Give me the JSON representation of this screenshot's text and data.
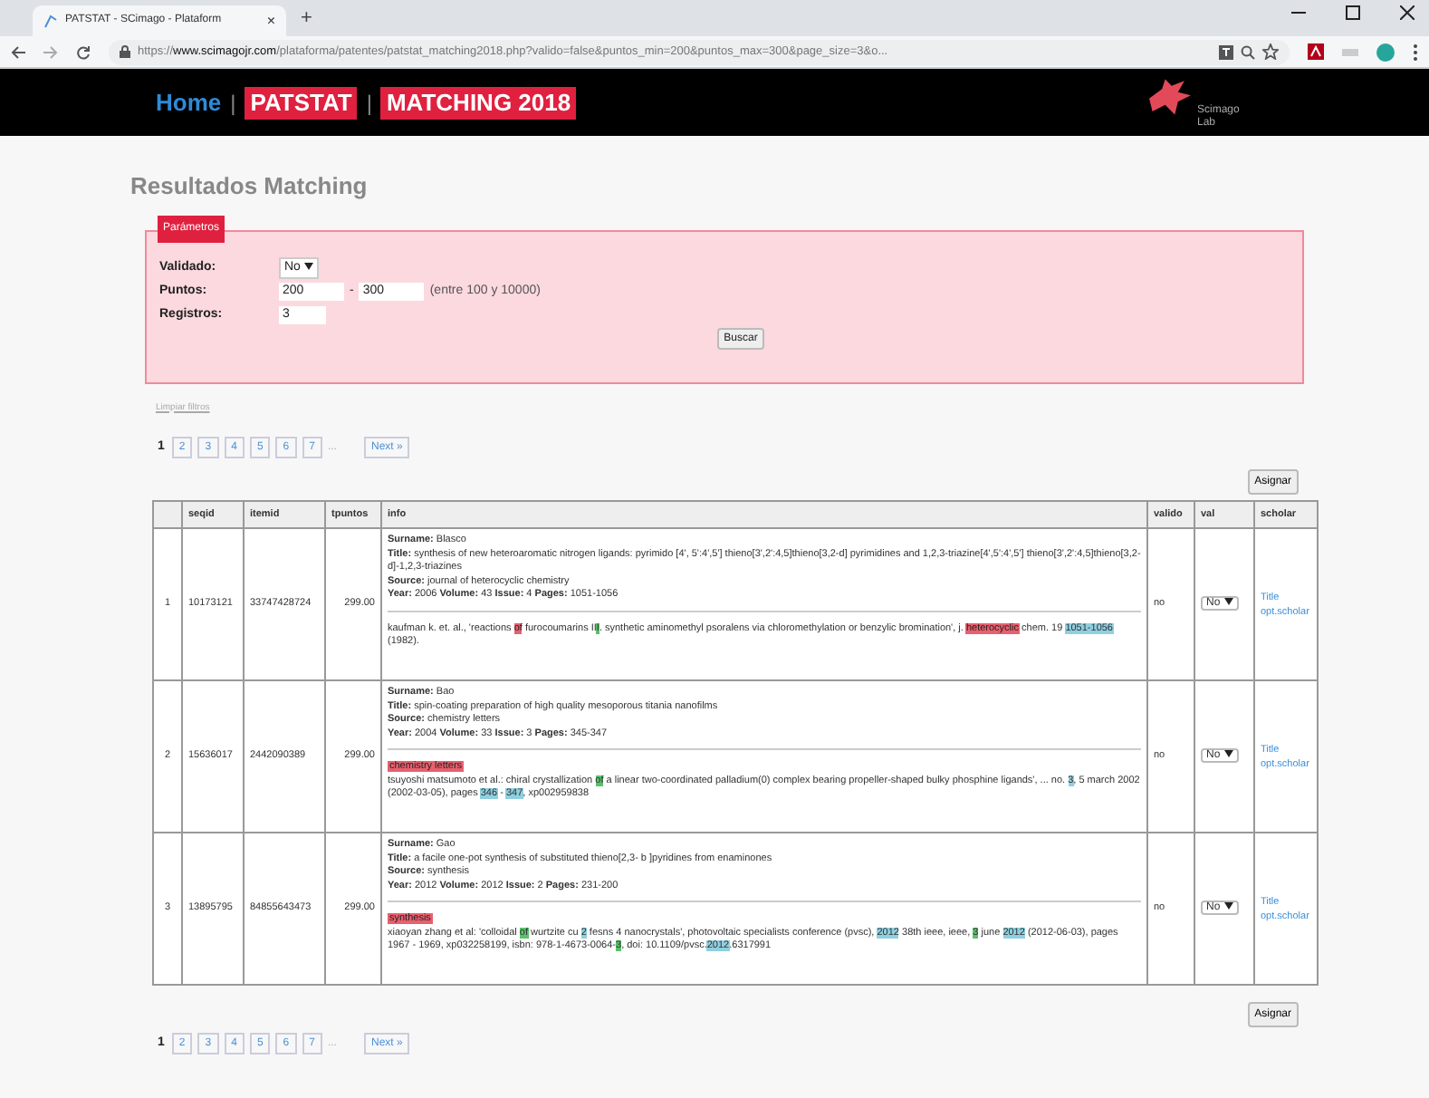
{
  "browser": {
    "tab_title": "PATSTAT - SCimago - Plataform",
    "tab_close": "×",
    "new_tab": "+",
    "url_scheme": "https://",
    "url_host": "www.scimagojr.com",
    "url_path": "/plataforma/patentes/patstat_matching2018.php?valido=false&puntos_min=200&puntos_max=300&page_size=3&o..."
  },
  "header": {
    "nav": [
      {
        "label": "Home",
        "kind": "link"
      },
      {
        "label": "|",
        "kind": "separator"
      },
      {
        "label": "PATSTAT",
        "kind": "badge"
      },
      {
        "label": "|",
        "kind": "separator"
      },
      {
        "label": "MATCHING 2018",
        "kind": "badge"
      }
    ],
    "logo_text": "Scimago Lab"
  },
  "page_title": "Resultados Matching",
  "params": {
    "legend": "Parámetros",
    "validado_label": "Validado:",
    "validado_value": "No",
    "puntos_label": "Puntos:",
    "puntos_min": "200",
    "dash": "-",
    "puntos_max": "300",
    "puntos_hint": "(entre 100 y 10000)",
    "registros_label": "Registros:",
    "registros_value": "3",
    "button": "Buscar"
  },
  "clear_link": "Limpiar filtros",
  "pagination_top": {
    "pages": [
      {
        "label": "1",
        "selected": true
      },
      {
        "label": "2",
        "selected": false
      },
      {
        "label": "3",
        "selected": false
      },
      {
        "label": "4",
        "selected": false
      },
      {
        "label": "5",
        "selected": false
      },
      {
        "label": "6",
        "selected": false
      },
      {
        "label": "7",
        "selected": false
      }
    ],
    "ellipsis": "...",
    "next": "Next »"
  },
  "assign_top": "Asignar",
  "table": {
    "columns": [
      "seqid",
      "itemid",
      "tpuntos",
      "info",
      "valido",
      "val",
      "scholar"
    ],
    "rows": [
      {
        "index": "1",
        "seqid": "10173121",
        "itemid": "33747428724",
        "tpuntos": "299.00",
        "info_lines": [
          [
            {
              "label": "Surname:",
              "value": "Blasco"
            }
          ],
          [
            {
              "label": "Title:",
              "value": "synthesis of new heteroaromatic nitrogen ligands: pyrimido [4', 5':4',5'] thieno[3',2':4,5]thieno[3,2-d] pyrimidines and 1,2,3-triazine[4',5':4',5'] thieno[3',2':4,5]thieno[3,2-d]-1,2,3-triazines"
            }
          ],
          [
            {
              "label": "Source:",
              "value": "journal of heterocyclic chemistry"
            }
          ],
          [
            {
              "label": "Year:",
              "value": "2006"
            },
            {
              "label": "Volume:",
              "value": "43"
            },
            {
              "label": "Issue:",
              "value": "4"
            },
            {
              "label": "Pages:",
              "value": "1051-1056"
            }
          ]
        ],
        "citation": [
          {
            "text": "kaufman k. et. al., 'reactions ",
            "kind": "plain"
          },
          {
            "text": "of",
            "kind": "red"
          },
          {
            "text": " furocoumarins II",
            "kind": "plain"
          },
          {
            "text": "I",
            "kind": "green"
          },
          {
            "text": ". synthetic aminomethyl psoralens via chloromethylation or benzylic bromination', j. ",
            "kind": "plain"
          },
          {
            "text": "heterocyclic",
            "kind": "red"
          },
          {
            "text": " chem. 19 ",
            "kind": "plain"
          },
          {
            "text": "1051-1056",
            "kind": "blue"
          },
          {
            "text": " (1982).",
            "kind": "plain"
          }
        ],
        "valido": "no",
        "val": "No",
        "scholar": [
          "Title",
          "opt.scholar"
        ]
      },
      {
        "index": "2",
        "seqid": "15636017",
        "itemid": "2442090389",
        "tpuntos": "299.00",
        "info_lines": [
          [
            {
              "label": "Surname:",
              "value": "Bao"
            }
          ],
          [
            {
              "label": "Title:",
              "value": "spin-coating preparation of high quality mesoporous titania nanofilms"
            }
          ],
          [
            {
              "label": "Source:",
              "value": "chemistry letters"
            }
          ],
          [
            {
              "label": "Year:",
              "value": "2004"
            },
            {
              "label": "Volume:",
              "value": "33"
            },
            {
              "label": "Issue:",
              "value": "3"
            },
            {
              "label": "Pages:",
              "value": "345-347"
            }
          ]
        ],
        "source_tag": "chemistry letters",
        "citation": [
          {
            "text": "tsuyoshi matsumoto et al.: chiral crystallization ",
            "kind": "plain"
          },
          {
            "text": "of",
            "kind": "green"
          },
          {
            "text": " a linear two-coordinated palladium(0) complex bearing propeller-shaped bulky phosphine ligands', ... no. ",
            "kind": "plain"
          },
          {
            "text": "3",
            "kind": "blue"
          },
          {
            "text": ", 5 march 2002 (2002-03-05), pages ",
            "kind": "plain"
          },
          {
            "text": "346",
            "kind": "blue"
          },
          {
            "text": " - ",
            "kind": "plain"
          },
          {
            "text": "347",
            "kind": "blue"
          },
          {
            "text": ", xp002959838",
            "kind": "plain"
          }
        ],
        "valido": "no",
        "val": "No",
        "scholar": [
          "Title",
          "opt.scholar"
        ]
      },
      {
        "index": "3",
        "seqid": "13895795",
        "itemid": "84855643473",
        "tpuntos": "299.00",
        "info_lines": [
          [
            {
              "label": "Surname:",
              "value": "Gao"
            }
          ],
          [
            {
              "label": "Title:",
              "value": "a facile one-pot synthesis of substituted thieno[2,3- b ]pyridines from enaminones"
            }
          ],
          [
            {
              "label": "Source:",
              "value": "synthesis"
            }
          ],
          [
            {
              "label": "Year:",
              "value": "2012"
            },
            {
              "label": "Volume:",
              "value": "2012"
            },
            {
              "label": "Issue:",
              "value": "2"
            },
            {
              "label": "Pages:",
              "value": "231-200"
            }
          ]
        ],
        "source_tag": "synthesis",
        "citation": [
          {
            "text": "xiaoyan zhang et al: 'colloidal ",
            "kind": "plain"
          },
          {
            "text": "of",
            "kind": "green"
          },
          {
            "text": " wurtzite cu ",
            "kind": "plain"
          },
          {
            "text": "2",
            "kind": "blue"
          },
          {
            "text": " fesns 4 nanocrystals', photovoltaic specialists conference (pvsc), ",
            "kind": "plain"
          },
          {
            "text": "2012",
            "kind": "blue"
          },
          {
            "text": " 38th ieee, ieee, ",
            "kind": "plain"
          },
          {
            "text": "3",
            "kind": "green"
          },
          {
            "text": " june ",
            "kind": "plain"
          },
          {
            "text": "2012",
            "kind": "blue"
          },
          {
            "text": " (2012-06-03), pages 1967 - 1969, xp032258199, isbn: 978-1-4673-0064-",
            "kind": "plain"
          },
          {
            "text": "3",
            "kind": "green"
          },
          {
            "text": ", doi: 10.1109/pvsc.",
            "kind": "plain"
          },
          {
            "text": "2012",
            "kind": "blue"
          },
          {
            "text": ".6317991",
            "kind": "plain"
          }
        ],
        "valido": "no",
        "val": "No",
        "scholar": [
          "Title",
          "opt.scholar"
        ]
      }
    ]
  },
  "assign_bottom": "Asignar",
  "pagination_bottom": {
    "pages": [
      {
        "label": "1",
        "selected": true
      },
      {
        "label": "2",
        "selected": false
      },
      {
        "label": "3",
        "selected": false
      },
      {
        "label": "4",
        "selected": false
      },
      {
        "label": "5",
        "selected": false
      },
      {
        "label": "6",
        "selected": false
      },
      {
        "label": "7",
        "selected": false
      }
    ],
    "ellipsis": "...",
    "next": "Next »"
  }
}
